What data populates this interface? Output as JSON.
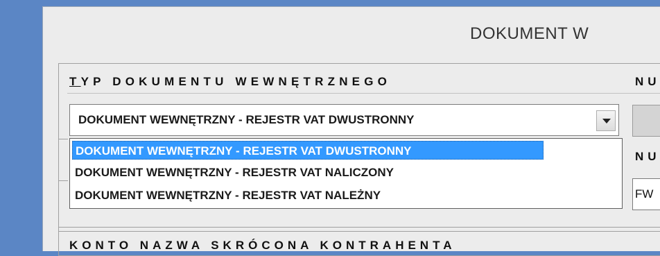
{
  "window": {
    "title": "DOKUMENT W"
  },
  "group": {
    "title_first": "T",
    "title_rest": "YP DOKUMENTU WEWNĘTRZNEGO",
    "number_label_1": "NU",
    "number_label_2": "NU",
    "number_value": "FW"
  },
  "combo": {
    "selected": "DOKUMENT WEWNĘTRZNY - REJESTR VAT DWUSTRONNY",
    "options": [
      "DOKUMENT WEWNĘTRZNY - REJESTR VAT DWUSTRONNY",
      "DOKUMENT WEWNĘTRZNY - REJESTR VAT NALICZONY",
      "DOKUMENT WEWNĘTRZNY - REJESTR VAT NALEŻNY"
    ]
  },
  "bottom": {
    "header": "KONTO      NAZWA SKRÓCONA KONTRAHENTA"
  },
  "colors": {
    "desktop": "#5b86c5",
    "selection": "#3399ff"
  }
}
